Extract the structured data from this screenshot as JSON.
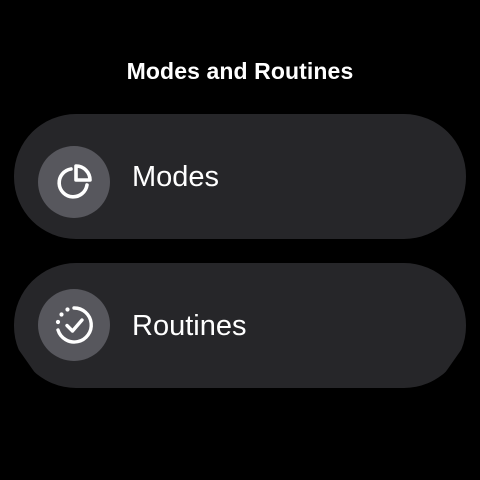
{
  "header": {
    "title": "Modes and Routines"
  },
  "menu": {
    "items": [
      {
        "label": "Modes",
        "icon": "modes-pie-icon"
      },
      {
        "label": "Routines",
        "icon": "routine-check-icon"
      }
    ]
  },
  "colors": {
    "background": "#000000",
    "card": "#262629",
    "icon_circle": "#57575d",
    "text": "#ffffff"
  }
}
